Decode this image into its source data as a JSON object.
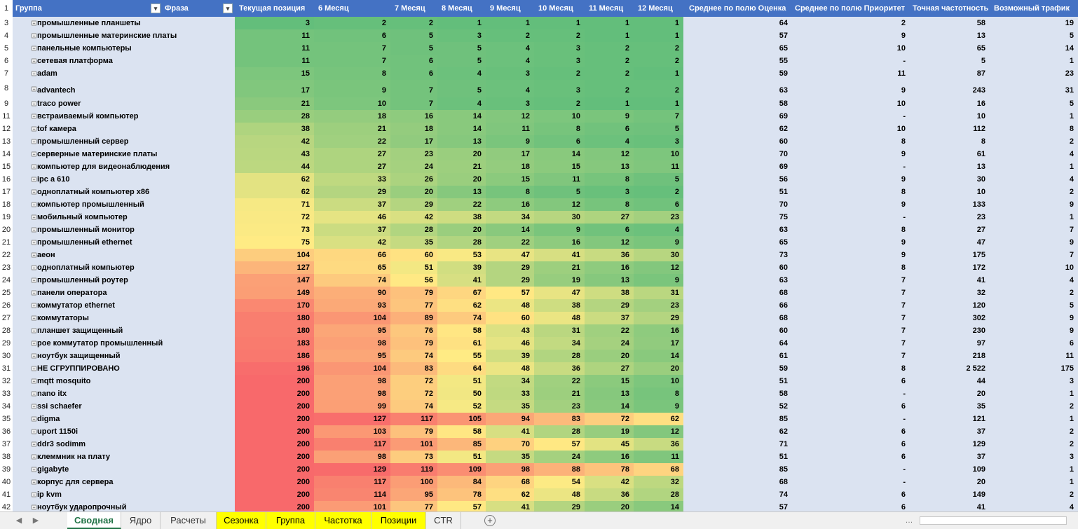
{
  "header": {
    "row_number": "1",
    "columns": [
      "Группа",
      "Фраза",
      "Текущая позиция",
      "6 Месяц",
      "7 Месяц",
      "8 Месяц",
      "9 Месяц",
      "10 Месяц",
      "11 Месяц",
      "12 Месяц",
      "Среднее по полю Оценка",
      "Среднее по полю Приоритет",
      "Точная частотность",
      "Возможный трафик"
    ]
  },
  "expand_symbol": "+",
  "rows": [
    [
      "3",
      "промышленные планшеты",
      "3",
      "2",
      "2",
      "1",
      "1",
      "1",
      "1",
      "1",
      "64",
      "2",
      "58",
      "19"
    ],
    [
      "4",
      "промышленные материнские платы",
      "11",
      "6",
      "5",
      "3",
      "2",
      "2",
      "1",
      "1",
      "57",
      "9",
      "13",
      "5"
    ],
    [
      "5",
      "панельные компьютеры",
      "11",
      "7",
      "5",
      "5",
      "4",
      "3",
      "2",
      "2",
      "65",
      "10",
      "65",
      "14"
    ],
    [
      "6",
      "сетевая платформа",
      "11",
      "7",
      "6",
      "5",
      "4",
      "3",
      "2",
      "2",
      "55",
      "-",
      "5",
      "1"
    ],
    [
      "7",
      "adam",
      "15",
      "8",
      "6",
      "4",
      "3",
      "2",
      "2",
      "1",
      "59",
      "11",
      "87",
      "23"
    ],
    [
      "8",
      "advantech",
      "17",
      "9",
      "7",
      "5",
      "4",
      "3",
      "2",
      "2",
      "63",
      "9",
      "243",
      "31"
    ],
    [
      "9",
      "traco power",
      "21",
      "10",
      "7",
      "4",
      "3",
      "2",
      "1",
      "1",
      "58",
      "10",
      "16",
      "5"
    ],
    [
      "11",
      "встраиваемый компьютер",
      "28",
      "18",
      "16",
      "14",
      "12",
      "10",
      "9",
      "7",
      "69",
      "-",
      "10",
      "1"
    ],
    [
      "12",
      "tof камера",
      "38",
      "21",
      "18",
      "14",
      "11",
      "8",
      "6",
      "5",
      "62",
      "10",
      "112",
      "8"
    ],
    [
      "13",
      "промышленный сервер",
      "42",
      "22",
      "17",
      "13",
      "9",
      "6",
      "4",
      "3",
      "60",
      "8",
      "8",
      "2"
    ],
    [
      "14",
      "серверные материнские платы",
      "43",
      "27",
      "23",
      "20",
      "17",
      "14",
      "12",
      "10",
      "70",
      "9",
      "61",
      "4"
    ],
    [
      "15",
      "компьютер для видеонаблюдения",
      "44",
      "27",
      "24",
      "21",
      "18",
      "15",
      "13",
      "11",
      "69",
      "-",
      "13",
      "1"
    ],
    [
      "16",
      "ipc a 610",
      "62",
      "33",
      "26",
      "20",
      "15",
      "11",
      "8",
      "5",
      "56",
      "9",
      "30",
      "4"
    ],
    [
      "17",
      "одноплатный компьютер x86",
      "62",
      "29",
      "20",
      "13",
      "8",
      "5",
      "3",
      "2",
      "51",
      "8",
      "10",
      "2"
    ],
    [
      "18",
      "компьютер промышленный",
      "71",
      "37",
      "29",
      "22",
      "16",
      "12",
      "8",
      "6",
      "70",
      "9",
      "133",
      "9"
    ],
    [
      "19",
      "мобильный компьютер",
      "72",
      "46",
      "42",
      "38",
      "34",
      "30",
      "27",
      "23",
      "75",
      "-",
      "23",
      "1"
    ],
    [
      "20",
      "промышленный монитор",
      "73",
      "37",
      "28",
      "20",
      "14",
      "9",
      "6",
      "4",
      "63",
      "8",
      "27",
      "7"
    ],
    [
      "21",
      "промышленный ethernet",
      "75",
      "42",
      "35",
      "28",
      "22",
      "16",
      "12",
      "9",
      "65",
      "9",
      "47",
      "9"
    ],
    [
      "22",
      "аеон",
      "104",
      "66",
      "60",
      "53",
      "47",
      "41",
      "36",
      "30",
      "73",
      "9",
      "175",
      "7"
    ],
    [
      "23",
      "одноплатный компьютер",
      "127",
      "65",
      "51",
      "39",
      "29",
      "21",
      "16",
      "12",
      "60",
      "8",
      "172",
      "10"
    ],
    [
      "24",
      "промышленный роутер",
      "147",
      "74",
      "56",
      "41",
      "29",
      "19",
      "13",
      "9",
      "63",
      "7",
      "41",
      "4"
    ],
    [
      "25",
      "панели оператора",
      "149",
      "90",
      "79",
      "67",
      "57",
      "47",
      "38",
      "31",
      "68",
      "7",
      "32",
      "2"
    ],
    [
      "26",
      "коммутатор ethernet",
      "170",
      "93",
      "77",
      "62",
      "48",
      "38",
      "29",
      "23",
      "66",
      "7",
      "120",
      "5"
    ],
    [
      "27",
      "коммутаторы",
      "180",
      "104",
      "89",
      "74",
      "60",
      "48",
      "37",
      "29",
      "68",
      "7",
      "302",
      "9"
    ],
    [
      "28",
      "планшет защищенный",
      "180",
      "95",
      "76",
      "58",
      "43",
      "31",
      "22",
      "16",
      "60",
      "7",
      "230",
      "9"
    ],
    [
      "29",
      "рое коммутатор промышленный",
      "183",
      "98",
      "79",
      "61",
      "46",
      "34",
      "24",
      "17",
      "64",
      "7",
      "97",
      "6"
    ],
    [
      "30",
      "ноутбук защищенный",
      "186",
      "95",
      "74",
      "55",
      "39",
      "28",
      "20",
      "14",
      "61",
      "7",
      "218",
      "11"
    ],
    [
      "31",
      "НЕ СГРУППИРОВАНО",
      "196",
      "104",
      "83",
      "64",
      "48",
      "36",
      "27",
      "20",
      "59",
      "8",
      "2 522",
      "175"
    ],
    [
      "32",
      "mqtt mosquito",
      "200",
      "98",
      "72",
      "51",
      "34",
      "22",
      "15",
      "10",
      "51",
      "6",
      "44",
      "3"
    ],
    [
      "33",
      "nano itx",
      "200",
      "98",
      "72",
      "50",
      "33",
      "21",
      "13",
      "8",
      "58",
      "-",
      "20",
      "1"
    ],
    [
      "34",
      "ssi schaefer",
      "200",
      "99",
      "74",
      "52",
      "35",
      "23",
      "14",
      "9",
      "52",
      "6",
      "35",
      "2"
    ],
    [
      "35",
      "digma",
      "200",
      "127",
      "117",
      "105",
      "94",
      "83",
      "72",
      "62",
      "85",
      "-",
      "121",
      "1"
    ],
    [
      "36",
      "uport 1150i",
      "200",
      "103",
      "79",
      "58",
      "41",
      "28",
      "19",
      "12",
      "62",
      "6",
      "37",
      "2"
    ],
    [
      "37",
      "ddr3 sodimm",
      "200",
      "117",
      "101",
      "85",
      "70",
      "57",
      "45",
      "36",
      "71",
      "6",
      "129",
      "2"
    ],
    [
      "38",
      "клеммник на плату",
      "200",
      "98",
      "73",
      "51",
      "35",
      "24",
      "16",
      "11",
      "51",
      "6",
      "37",
      "3"
    ],
    [
      "39",
      "gigabyte",
      "200",
      "129",
      "119",
      "109",
      "98",
      "88",
      "78",
      "68",
      "85",
      "-",
      "109",
      "1"
    ],
    [
      "40",
      "корпус для сервера",
      "200",
      "117",
      "100",
      "84",
      "68",
      "54",
      "42",
      "32",
      "68",
      "-",
      "20",
      "1"
    ],
    [
      "41",
      "ip kvm",
      "200",
      "114",
      "95",
      "78",
      "62",
      "48",
      "36",
      "28",
      "74",
      "6",
      "149",
      "2"
    ],
    [
      "42",
      "ноутбук ударопрочный",
      "200",
      "101",
      "77",
      "57",
      "41",
      "29",
      "20",
      "14",
      "57",
      "6",
      "41",
      "4"
    ]
  ],
  "sheet_tabs": [
    {
      "label": "Сводная",
      "active": true,
      "yellow": false
    },
    {
      "label": "Ядро",
      "active": false,
      "yellow": false
    },
    {
      "label": "Расчеты",
      "active": false,
      "yellow": false
    },
    {
      "label": "Сезонка",
      "active": false,
      "yellow": true
    },
    {
      "label": "Группа",
      "active": false,
      "yellow": true
    },
    {
      "label": "Частотка",
      "active": false,
      "yellow": true
    },
    {
      "label": "Позиции",
      "active": false,
      "yellow": true
    },
    {
      "label": "CTR",
      "active": false,
      "yellow": false
    }
  ],
  "nav": {
    "prev": "◀",
    "next": "▶",
    "more": "…",
    "add": "+"
  },
  "colors": {
    "header": "#4472c4",
    "tab_active": "#217346",
    "tab_yellow": "#ffff00",
    "phrase_bg": "#dbe3f1"
  }
}
